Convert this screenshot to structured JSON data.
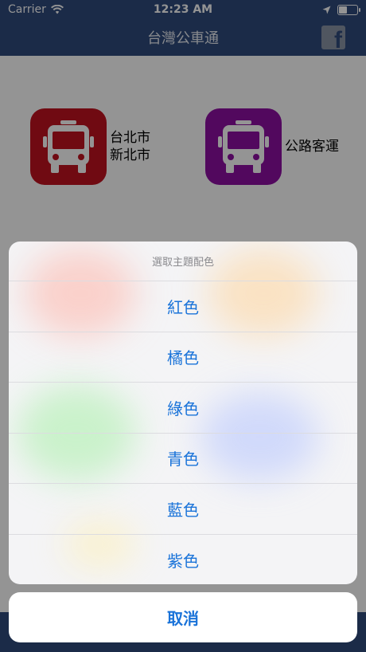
{
  "status_bar": {
    "carrier": "Carrier",
    "time": "12:23 AM",
    "wifi_icon": "wifi-icon",
    "location_icon": "location-arrow-icon",
    "battery_icon": "battery-icon"
  },
  "nav": {
    "title": "台灣公車通",
    "share_icon": "facebook-icon",
    "share_glyph": "f"
  },
  "main": {
    "items": [
      {
        "label_line1": "台北市",
        "label_line2": "新北市",
        "icon": "bus-icon",
        "color": "#c1121f"
      },
      {
        "label_line1": "公路客運",
        "label_line2": "",
        "icon": "bus-icon",
        "color": "#8e0ea3"
      }
    ]
  },
  "action_sheet": {
    "title": "選取主題配色",
    "options": [
      "紅色",
      "橘色",
      "綠色",
      "青色",
      "藍色",
      "紫色"
    ],
    "cancel": "取消"
  },
  "colors": {
    "nav_bg": "#304b7c",
    "action_text": "#1a73d9"
  }
}
